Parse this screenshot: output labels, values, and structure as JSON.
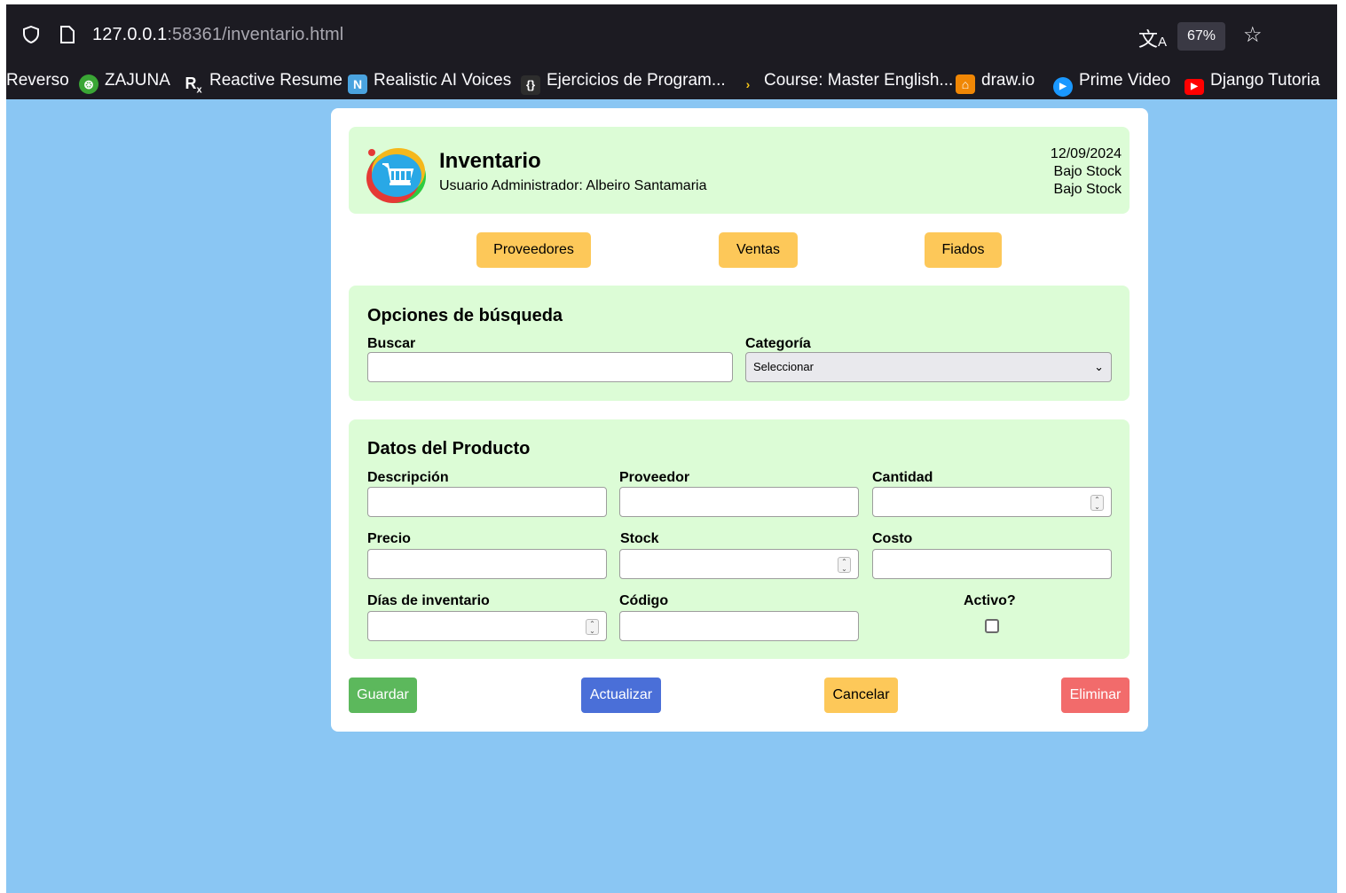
{
  "browser": {
    "url_host": "127.0.0.1",
    "url_rest": ":58361/inventario.html",
    "zoom": "67%",
    "bookmarks": [
      {
        "label": "Reverso",
        "icon": "none"
      },
      {
        "label": "ZAJUNA",
        "icon": "zajuna-icon"
      },
      {
        "label": "Reactive Resume",
        "icon": "rx-icon"
      },
      {
        "label": "Realistic AI Voices",
        "icon": "n-icon"
      },
      {
        "label": "Ejercicios de Program...",
        "icon": "braces-icon"
      },
      {
        "label": "Course: Master English...",
        "icon": "play-arrow-icon"
      },
      {
        "label": "draw.io",
        "icon": "drawio-icon"
      },
      {
        "label": "Prime Video",
        "icon": "prime-video-icon"
      },
      {
        "label": "Django Tutoria",
        "icon": "youtube-icon"
      }
    ]
  },
  "header": {
    "title": "Inventario",
    "user": "Usuario Administrador: Albeiro Santamaria",
    "date": "12/09/2024",
    "alert1": "Bajo Stock",
    "alert2": "Bajo Stock"
  },
  "nav": {
    "proveedores": "Proveedores",
    "ventas": "Ventas",
    "fiados": "Fiados"
  },
  "search": {
    "title": "Opciones de búsqueda",
    "buscar_label": "Buscar",
    "buscar_value": "",
    "categoria_label": "Categoría",
    "categoria_selected": "Seleccionar"
  },
  "producto": {
    "title": "Datos del Producto",
    "descripcion_label": "Descripción",
    "proveedor_label": "Proveedor",
    "cantidad_label": "Cantidad",
    "precio_label": "Precio",
    "stock_label": "Stock",
    "costo_label": "Costo",
    "dias_label": "Días de inventario",
    "codigo_label": "Código",
    "activo_label": "Activo?",
    "activo_checked": false
  },
  "actions": {
    "guardar": "Guardar",
    "actualizar": "Actualizar",
    "cancelar": "Cancelar",
    "eliminar": "Eliminar"
  },
  "colors": {
    "page_bg": "#8ac6f3",
    "panel_bg": "#dcfcd6",
    "nav_button": "#fdc859",
    "guardar": "#5cb85c",
    "actualizar": "#4a6fd8",
    "cancelar": "#fdc859",
    "eliminar": "#f26b6b"
  }
}
